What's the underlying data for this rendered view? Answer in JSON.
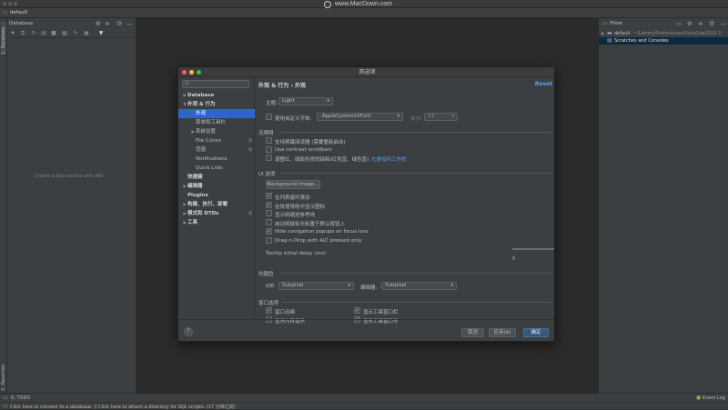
{
  "watermark": "www.MacDown.com",
  "breadcrumb": {
    "project": "default"
  },
  "left_stripe": {
    "database_tab": "1: Database",
    "favorites_tab": "2: Favorites"
  },
  "db_panel": {
    "title": "Database",
    "empty_text": "Create a data source with ⌘N"
  },
  "files_panel": {
    "title": "Files",
    "rows": [
      {
        "label": "default",
        "path": "~/Library/Preferences/DataGrip2019.3"
      },
      {
        "label": "Scratches and Consoles"
      }
    ]
  },
  "bottom_tools": {
    "todo": "6: TODO",
    "event_log": "Event Log"
  },
  "status_bar": {
    "text": "Click here to connect to a database. // Click here to attach a directory for SQL scripts. (17 分钟之前)"
  },
  "dialog": {
    "title": "首选项",
    "search_placeholder": "Q-",
    "breadcrumb": "外观 & 行为  ›  外观",
    "reset": "Reset",
    "tree": [
      {
        "label": "Database",
        "arrow": "▶",
        "bold": true,
        "indent": 0
      },
      {
        "label": "外观 & 行为",
        "arrow": "▼",
        "bold": true,
        "indent": 0
      },
      {
        "label": "外观",
        "arrow": "",
        "bold": false,
        "indent": 1,
        "selected": true
      },
      {
        "label": "菜单和工具栏",
        "arrow": "",
        "bold": false,
        "indent": 1
      },
      {
        "label": "系统设置",
        "arrow": "▶",
        "bold": false,
        "indent": 1
      },
      {
        "label": "File Colors",
        "arrow": "",
        "bold": false,
        "indent": 1,
        "mark": "⧉"
      },
      {
        "label": "范围",
        "arrow": "",
        "bold": false,
        "indent": 1,
        "mark": "⧉"
      },
      {
        "label": "Notifications",
        "arrow": "",
        "bold": false,
        "indent": 1
      },
      {
        "label": "Quick Lists",
        "arrow": "",
        "bold": false,
        "indent": 1
      },
      {
        "label": "快捷键",
        "arrow": "",
        "bold": true,
        "indent": 0
      },
      {
        "label": "编辑器",
        "arrow": "▶",
        "bold": true,
        "indent": 0
      },
      {
        "label": "Plugins",
        "arrow": "",
        "bold": true,
        "indent": 0
      },
      {
        "label": "构建、执行、部署",
        "arrow": "▶",
        "bold": true,
        "indent": 0
      },
      {
        "label": "模式和 DTDs",
        "arrow": "▶",
        "bold": true,
        "indent": 0,
        "mark": "⧉"
      },
      {
        "label": "工具",
        "arrow": "▶",
        "bold": true,
        "indent": 0
      }
    ],
    "theme": {
      "label": "主题:",
      "value": "Light"
    },
    "custom_font": {
      "label": "使用自定义字体:",
      "value": ".AppleSystemUIFont",
      "size_label": "大小:",
      "size_value": "13",
      "checked": false
    },
    "accessibility": {
      "title": "无障碍",
      "items": [
        {
          "label": "支持屏幕阅读器 (需要重新启动)",
          "checked": false
        },
        {
          "label": "Use contrast scrollbars",
          "checked": false
        },
        {
          "label": "调整红、绿颜色视觉缺陷(红色盲、绿色盲)",
          "checked": false,
          "link": "它是如何工作的"
        }
      ]
    },
    "ui_options": {
      "title": "UI 选项",
      "bg_button": "Background Image...",
      "items": [
        {
          "label": "在列表循环滚动",
          "checked": true
        },
        {
          "label": "在快速导航中显示图标",
          "checked": true
        },
        {
          "label": "显示树缩进参考线",
          "checked": false
        },
        {
          "label": "自动将鼠标光标置于默认按钮上",
          "checked": false
        },
        {
          "label": "Hide navigation popups on focus loss",
          "checked": true
        },
        {
          "label": "Drag-n-Drop with ALT pressed only",
          "checked": false
        }
      ],
      "tooltip_label": "Tooltip initial delay (ms):",
      "tooltip_min": "0",
      "tooltip_max": "1200",
      "tooltip_value_fraction": 0.98
    },
    "antialiasing": {
      "title": "抗锯齿",
      "ide_label": "IDE:",
      "ide_value": "Subpixel",
      "editor_label": "编辑器:",
      "editor_value": "Subpixel"
    },
    "window_options": {
      "title": "窗口选项",
      "left": [
        {
          "label": "窗口动画",
          "checked": true
        },
        {
          "label": "显示内存指示",
          "checked": false
        }
      ],
      "right": [
        {
          "label": "显示工具窗口栏",
          "checked": true
        },
        {
          "label": "显示工具窗口号",
          "checked": true
        }
      ]
    },
    "buttons": {
      "help": "?",
      "cancel": "取消",
      "apply": "应用(A)",
      "ok": "确定"
    }
  },
  "colors": {
    "accent": "#2f65ca",
    "link": "#589df6",
    "primary_button": "#365880"
  }
}
